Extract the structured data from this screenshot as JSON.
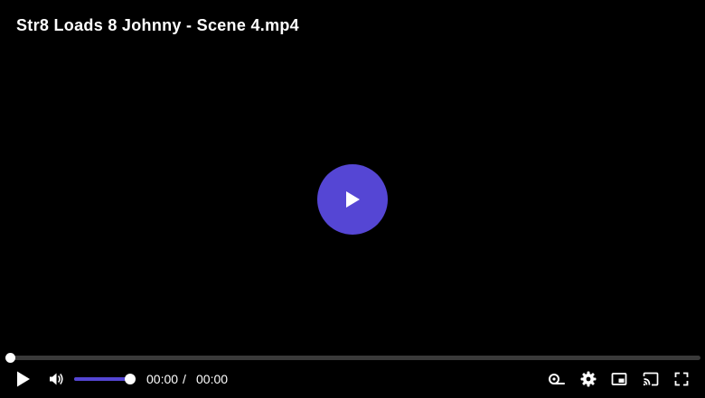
{
  "video": {
    "title": "Str8 Loads 8 Johnny - Scene 4.mp4"
  },
  "colors": {
    "accent": "#5546d4",
    "track": "#3a3a3a",
    "icon": "#ffffff",
    "background": "#000000"
  },
  "playback": {
    "current_time": "00:00",
    "separator": "/",
    "duration": "00:00",
    "progress_fraction": 0.0,
    "volume_fraction": 1.0
  },
  "icons": {
    "big_play": "play-icon",
    "play": "play-icon",
    "volume": "volume-icon",
    "speed": "playback-speed-icon",
    "settings": "gear-icon",
    "pip": "picture-in-picture-icon",
    "cast": "cast-icon",
    "fullscreen": "fullscreen-icon"
  }
}
